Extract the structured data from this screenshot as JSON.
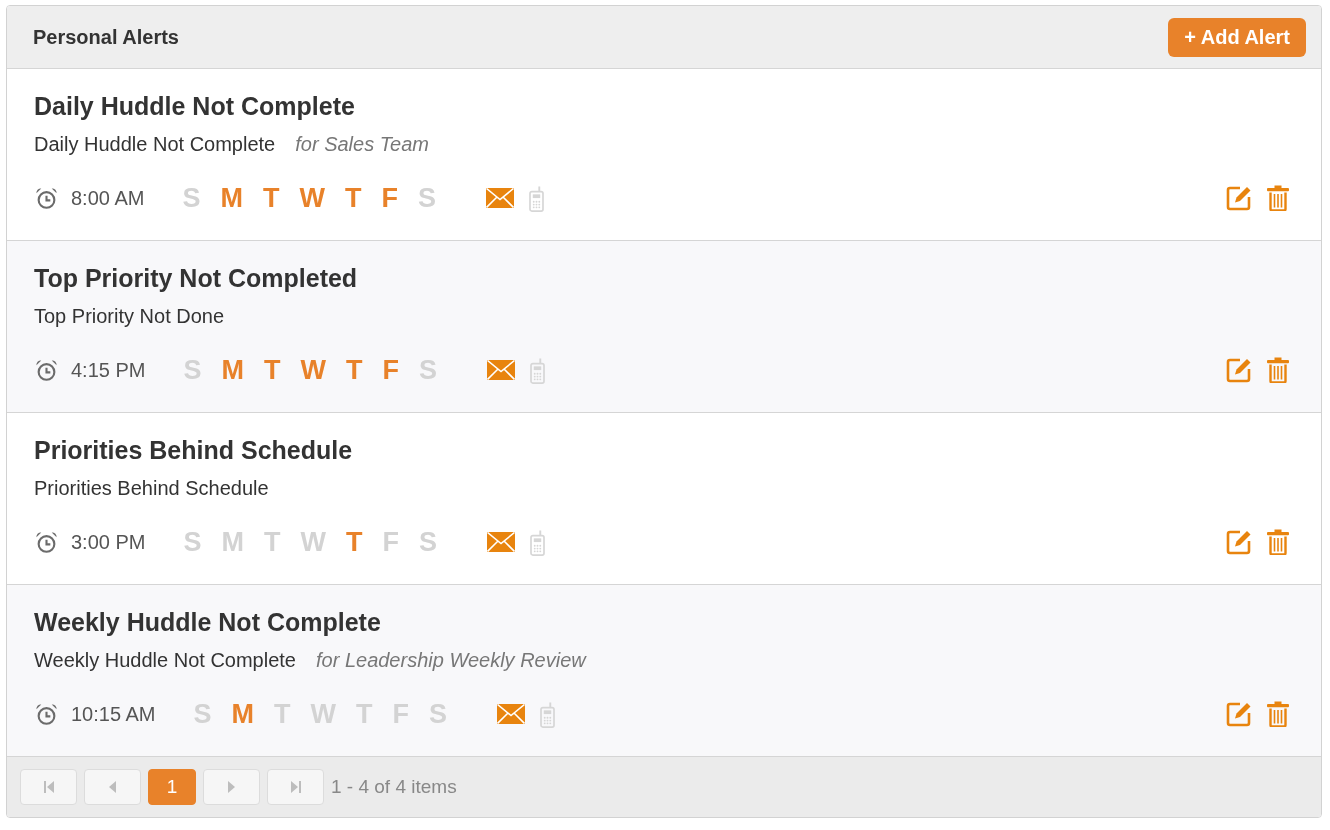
{
  "panel": {
    "title": "Personal Alerts",
    "add_button": "+ Add Alert"
  },
  "alerts": [
    {
      "title": "Daily Huddle Not Complete",
      "description": "Daily Huddle Not Complete",
      "audience": "for Sales Team",
      "time": "8:00 AM",
      "days": [
        {
          "label": "S",
          "on": false
        },
        {
          "label": "M",
          "on": true
        },
        {
          "label": "T",
          "on": true
        },
        {
          "label": "W",
          "on": true
        },
        {
          "label": "T",
          "on": true
        },
        {
          "label": "F",
          "on": true
        },
        {
          "label": "S",
          "on": false
        }
      ],
      "email": true,
      "sms": false
    },
    {
      "title": "Top Priority Not Completed",
      "description": "Top Priority Not Done",
      "time": "4:15 PM",
      "days": [
        {
          "label": "S",
          "on": false
        },
        {
          "label": "M",
          "on": true
        },
        {
          "label": "T",
          "on": true
        },
        {
          "label": "W",
          "on": true
        },
        {
          "label": "T",
          "on": true
        },
        {
          "label": "F",
          "on": true
        },
        {
          "label": "S",
          "on": false
        }
      ],
      "email": true,
      "sms": false
    },
    {
      "title": "Priorities Behind Schedule",
      "description": "Priorities Behind Schedule",
      "time": "3:00 PM",
      "days": [
        {
          "label": "S",
          "on": false
        },
        {
          "label": "M",
          "on": false
        },
        {
          "label": "T",
          "on": false
        },
        {
          "label": "W",
          "on": false
        },
        {
          "label": "T",
          "on": true
        },
        {
          "label": "F",
          "on": false
        },
        {
          "label": "S",
          "on": false
        }
      ],
      "email": true,
      "sms": false
    },
    {
      "title": "Weekly Huddle Not Complete",
      "description": "Weekly Huddle Not Complete",
      "audience": "for Leadership Weekly Review",
      "time": "10:15 AM",
      "days": [
        {
          "label": "S",
          "on": false
        },
        {
          "label": "M",
          "on": true
        },
        {
          "label": "T",
          "on": false
        },
        {
          "label": "W",
          "on": false
        },
        {
          "label": "T",
          "on": false
        },
        {
          "label": "F",
          "on": false
        },
        {
          "label": "S",
          "on": false
        }
      ],
      "email": true,
      "sms": false
    }
  ],
  "pager": {
    "controls": [
      {
        "kind": "first",
        "disabled": true
      },
      {
        "kind": "prev",
        "disabled": true
      },
      {
        "kind": "page",
        "label": "1",
        "selected": true
      },
      {
        "kind": "next",
        "disabled": true
      },
      {
        "kind": "last",
        "disabled": true
      }
    ],
    "summary": "1 - 4 of 4 items"
  }
}
